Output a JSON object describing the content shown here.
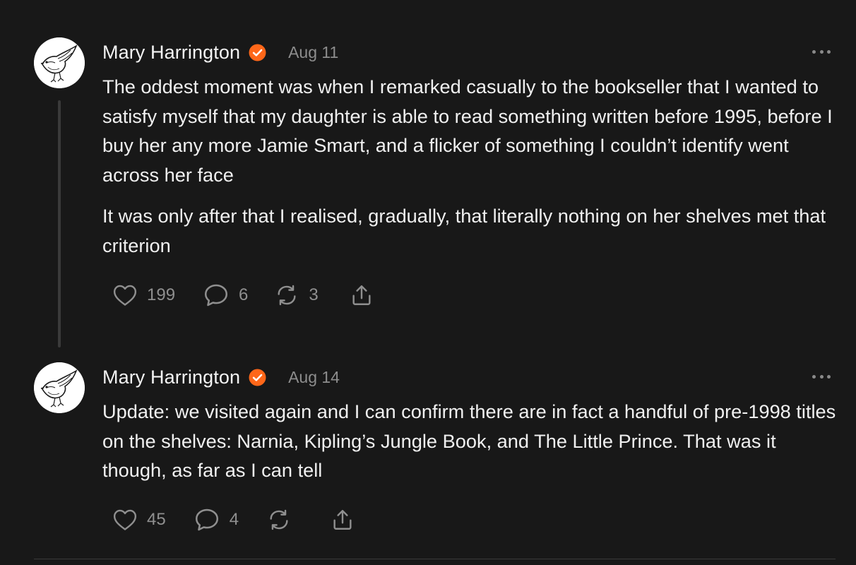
{
  "posts": [
    {
      "author": "Mary Harrington",
      "date": "Aug 11",
      "paragraphs": [
        "The oddest moment was when I remarked casually to the bookseller that I wanted to satisfy myself that my daughter is able to read something written before 1995, before I buy her any more Jamie Smart, and a flicker of something I couldn’t identify went across her face",
        "It was only after that I realised, gradually, that literally nothing on her shelves met that criterion"
      ],
      "likes": "199",
      "comments": "6",
      "restacks": "3"
    },
    {
      "author": "Mary Harrington",
      "date": "Aug 14",
      "paragraphs": [
        "Update: we visited again and I can confirm there are in fact a handful of pre-1998 titles on the shelves: Narnia, Kipling’s Jungle Book, and The Little Prince. That was it though, as far as I can tell"
      ],
      "likes": "45",
      "comments": "4",
      "restacks": ""
    }
  ],
  "icons": {
    "verified": "verified-badge-icon",
    "like": "heart-icon",
    "comment": "comment-bubble-icon",
    "restack": "restack-arrows-icon",
    "share": "share-upload-icon",
    "more": "more-dots-icon"
  },
  "colors": {
    "background": "#181818",
    "verified": "#ff6719",
    "muted": "#8d8d8d",
    "text": "#f0f0f0"
  }
}
